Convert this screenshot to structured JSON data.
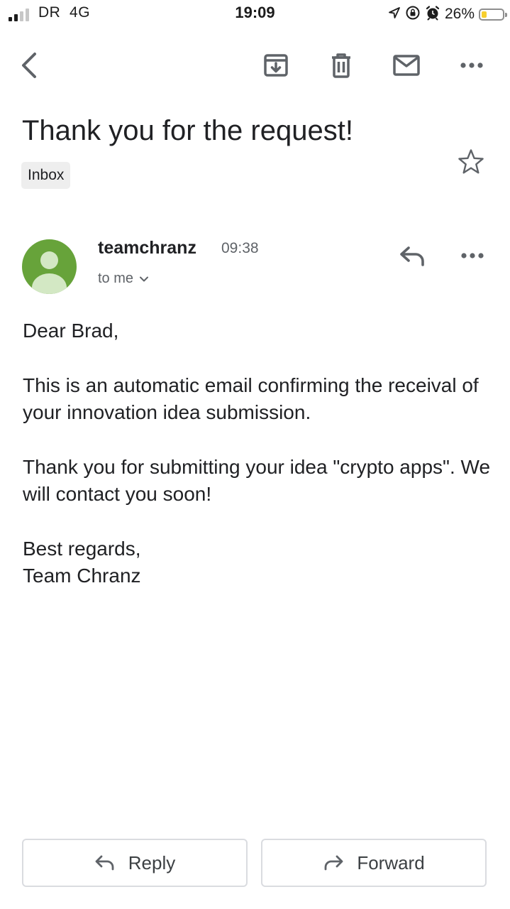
{
  "status_bar": {
    "carrier": "DR",
    "network": "4G",
    "time": "19:09",
    "battery_percent": "26%",
    "battery_level": 0.26,
    "battery_color": "#f7cf2f",
    "signal_bars_active": 2,
    "signal_bars_total": 4,
    "icons": [
      "location-arrow-icon",
      "orientation-lock-icon",
      "alarm-icon"
    ]
  },
  "toolbar": {
    "back_icon": "chevron-left-icon",
    "archive_icon": "archive-icon",
    "delete_icon": "trash-icon",
    "mark_unread_icon": "envelope-icon",
    "more_icon": "more-horizontal-icon"
  },
  "email": {
    "subject": "Thank you for the request!",
    "label": "Inbox",
    "star_icon": "star-outline-icon",
    "sender": "teamchranz",
    "time": "09:38",
    "recipient": "to me",
    "avatar_color": "#67a33a",
    "body": {
      "greeting": "Dear Brad,",
      "paragraph1": "This is an automatic email confirming the receival of your innovation idea submission.",
      "paragraph2": "Thank you for submitting your idea \"crypto apps\". We will contact you soon!",
      "closing_line1": "Best regards,",
      "closing_line2": "Team Chranz"
    }
  },
  "actions": {
    "reply_label": "Reply",
    "forward_label": "Forward"
  }
}
